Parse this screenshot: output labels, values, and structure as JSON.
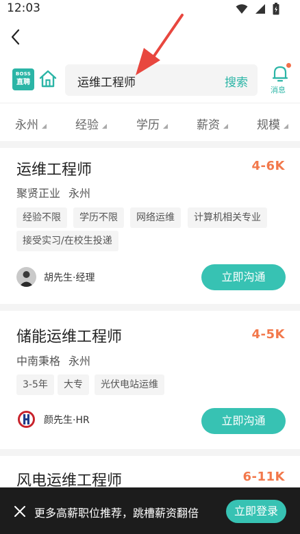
{
  "status_bar": {
    "time": "12:03"
  },
  "header": {
    "logo_line1": "BOSS",
    "logo_line2": "直聘",
    "search_query": "运维工程师",
    "search_button": "搜索",
    "messages_label": "消息",
    "accent_color": "#2bb5a6",
    "badge_color": "#f36f4a"
  },
  "filters": [
    "永州",
    "经验",
    "学历",
    "薪资",
    "规模"
  ],
  "jobs": [
    {
      "title": "运维工程师",
      "salary": "4-6K",
      "company": "聚贤正业",
      "city": "永州",
      "tags": [
        "经验不限",
        "学历不限",
        "网络运维",
        "计算机相关专业",
        "接受实习/在校生投递"
      ],
      "recruiter": "胡先生·经理",
      "chat_label": "立即沟通"
    },
    {
      "title": "储能运维工程师",
      "salary": "4-5K",
      "company": "中南秉格",
      "city": "永州",
      "tags": [
        "3-5年",
        "大专",
        "光伏电站运维"
      ],
      "recruiter": "颜先生·HR",
      "chat_label": "立即沟通"
    },
    {
      "title": "风电运维工程师",
      "salary": "6-11K"
    }
  ],
  "banner": {
    "text": "更多高薪职位推荐，跳槽薪资翻倍",
    "login_label": "立即登录"
  },
  "icons": {
    "back": "back-chevron-icon",
    "home": "home-icon",
    "messages": "bell-icon",
    "close": "close-icon"
  }
}
